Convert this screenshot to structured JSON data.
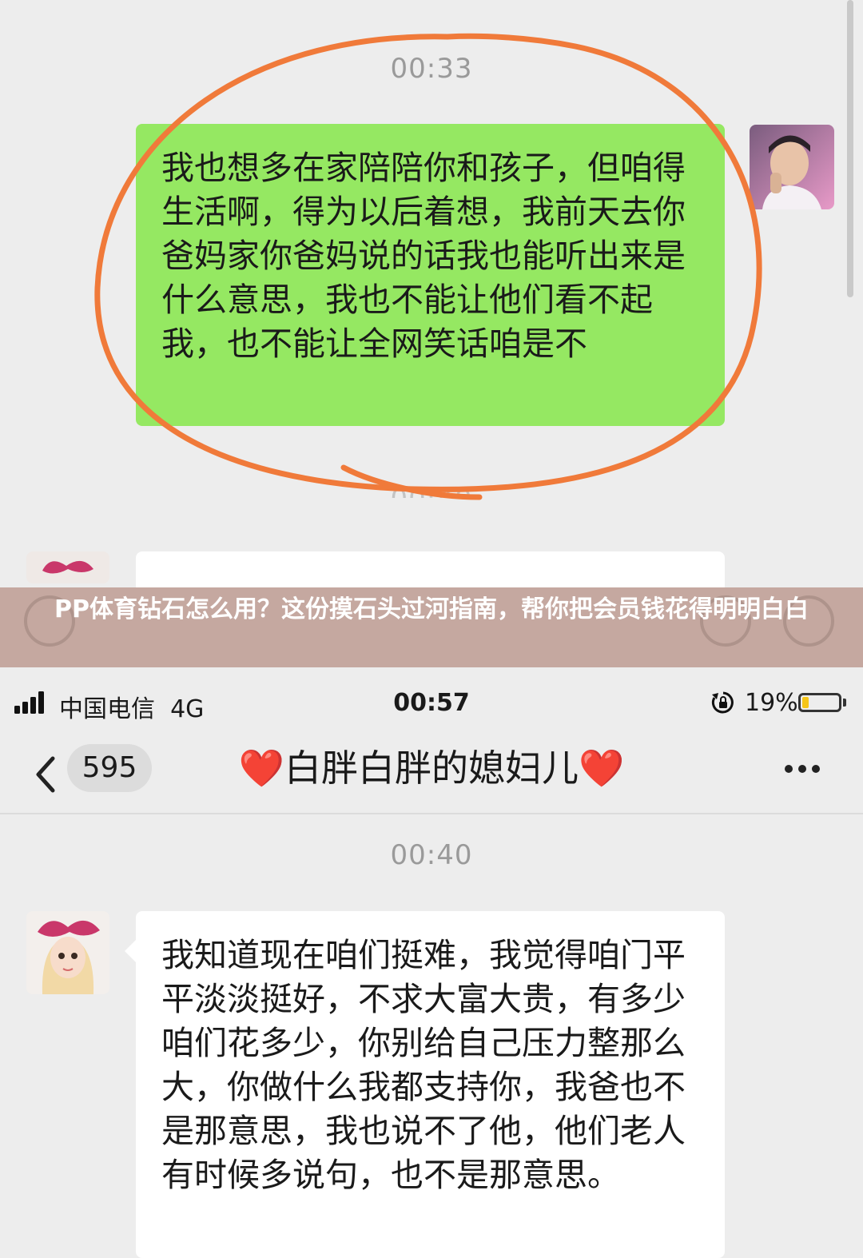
{
  "top": {
    "timestamp": "00:33",
    "message": "我也想多在家陪陪你和孩子，但咱得生活啊，得为以后着想，我前天去你爸妈家你爸妈说的话我也能听出来是什么意思，我也不能让他们看不起我，也不能让全网笑话咱是不",
    "next_timestamp_partial": "00:40"
  },
  "title_band": {
    "text": "PP体育钻石怎么用？这份摸石头过河指南，帮你把会员钱花得明明白白"
  },
  "phone": {
    "status": {
      "carrier": "中国电信",
      "network": "4G",
      "time": "00:57",
      "battery_percent_label": "19%",
      "battery_level": 0.19
    },
    "nav": {
      "unread_count": "595",
      "heart_left": "❤️",
      "contact_name": "白胖白胖的媳妇儿",
      "heart_right": "❤️"
    },
    "timestamp": "00:40",
    "message": "我知道现在咱们挺难，我觉得咱门平平淡淡挺好，不求大富大贵，有多少咱们花多少，你别给自己压力整那么大，你做什么我都支持你，我爸也不是那意思，我也说不了他，他们老人有时候多说句，也不是那意思。"
  },
  "colors": {
    "outgoing_bubble": "#95e862",
    "incoming_bubble": "#ffffff",
    "annotation_circle": "#f07a3a",
    "title_band": "#c5a8a0"
  }
}
